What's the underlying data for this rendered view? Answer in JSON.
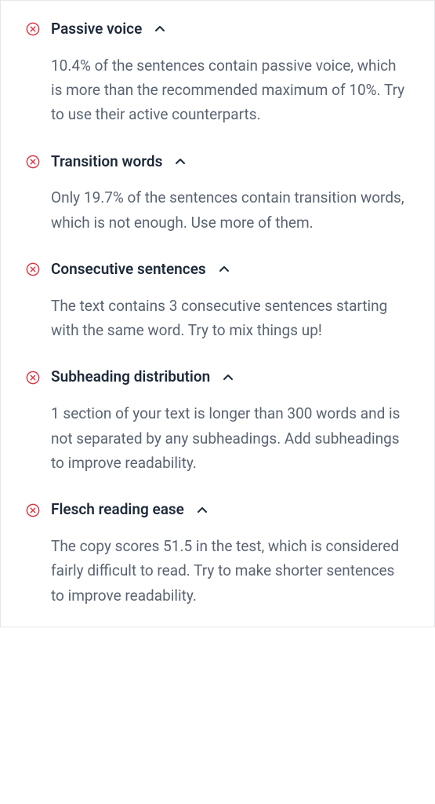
{
  "items": [
    {
      "title": "Passive voice",
      "description": "10.4% of the sentences contain passive voice, which is more than the recommended maximum of 10%. Try to use their active counterparts."
    },
    {
      "title": "Transition words",
      "description": "Only 19.7% of the sentences contain transition words, which is not enough. Use more of them."
    },
    {
      "title": "Consecutive sentences",
      "description": "The text contains 3 consecutive sentences starting with the same word. Try to mix things up!"
    },
    {
      "title": "Subheading distribution",
      "description": "1 section of your text is longer than 300 words and is not separated by any subheadings. Add subheadings to improve readability."
    },
    {
      "title": "Flesch reading ease",
      "description": "The copy scores 51.5 in the test, which is considered fairly difficult to read. Try to make shorter sentences to improve readability."
    }
  ]
}
